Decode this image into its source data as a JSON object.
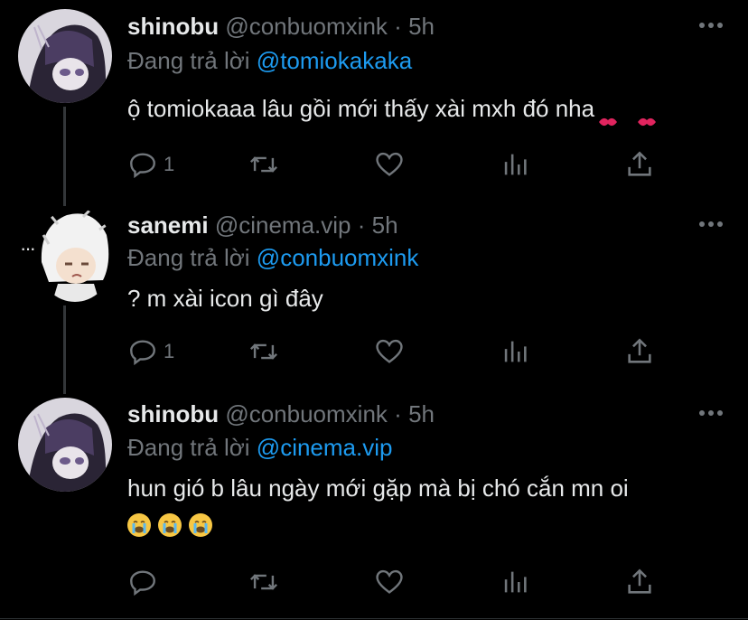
{
  "tweets": [
    {
      "name": "shinobu",
      "handle": "@conbuomxink",
      "dot": "·",
      "time": "5h",
      "reply_prefix": "Đang trả lời",
      "reply_to": "@tomiokakaka",
      "text": "ộ tomiokaaa lâu gồi mới thấy xài mxh đó nha",
      "reply_count": "1"
    },
    {
      "name": "sanemi",
      "handle": "@cinema.vip",
      "dot": "·",
      "time": "5h",
      "reply_prefix": "Đang trả lời",
      "reply_to": "@conbuomxink",
      "text": "? m xài icon gì đây",
      "reply_count": "1"
    },
    {
      "name": "shinobu",
      "handle": "@conbuomxink",
      "dot": "·",
      "time": "5h",
      "reply_prefix": "Đang trả lời",
      "reply_to": "@cinema.vip",
      "text": "hun gió b lâu ngày mới gặp mà bị chó cắn mn oi",
      "reply_count": ""
    }
  ],
  "thread_ellipsis": "···",
  "colors": {
    "background": "#000000",
    "text": "#e7e9ea",
    "muted": "#71767b",
    "link": "#1d9bf0"
  },
  "icons": [
    "reply-icon",
    "retweet-icon",
    "like-icon",
    "analytics-icon",
    "share-icon",
    "more-icon",
    "kiss-mark-icon",
    "crying-face-icon"
  ]
}
